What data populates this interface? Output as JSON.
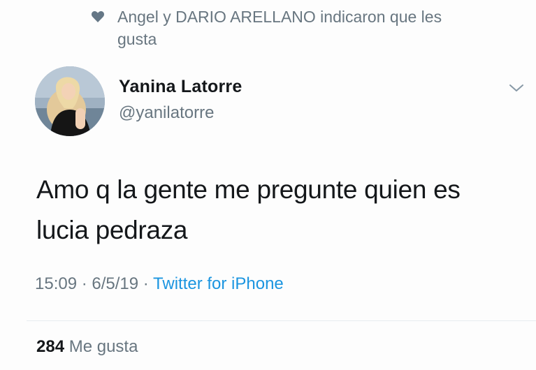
{
  "social_context": {
    "icon": "heart-icon",
    "text": "Angel y DARIO ARELLANO indicaron que les gusta"
  },
  "author": {
    "name": "Yanina Latorre",
    "handle": "@yanilatorre",
    "avatar": "profile-photo"
  },
  "tweet": {
    "text": "Amo q la gente me pregunte quien es lucia pedraza"
  },
  "meta": {
    "time": "15:09",
    "separator1": " · ",
    "date": "6/5/19",
    "separator2": " · ",
    "source": "Twitter for iPhone"
  },
  "stats": {
    "likes_count": "284",
    "likes_label": "Me gusta"
  },
  "colors": {
    "secondary_text": "#687680",
    "primary_text": "#14171a",
    "link": "#1b95e0"
  }
}
